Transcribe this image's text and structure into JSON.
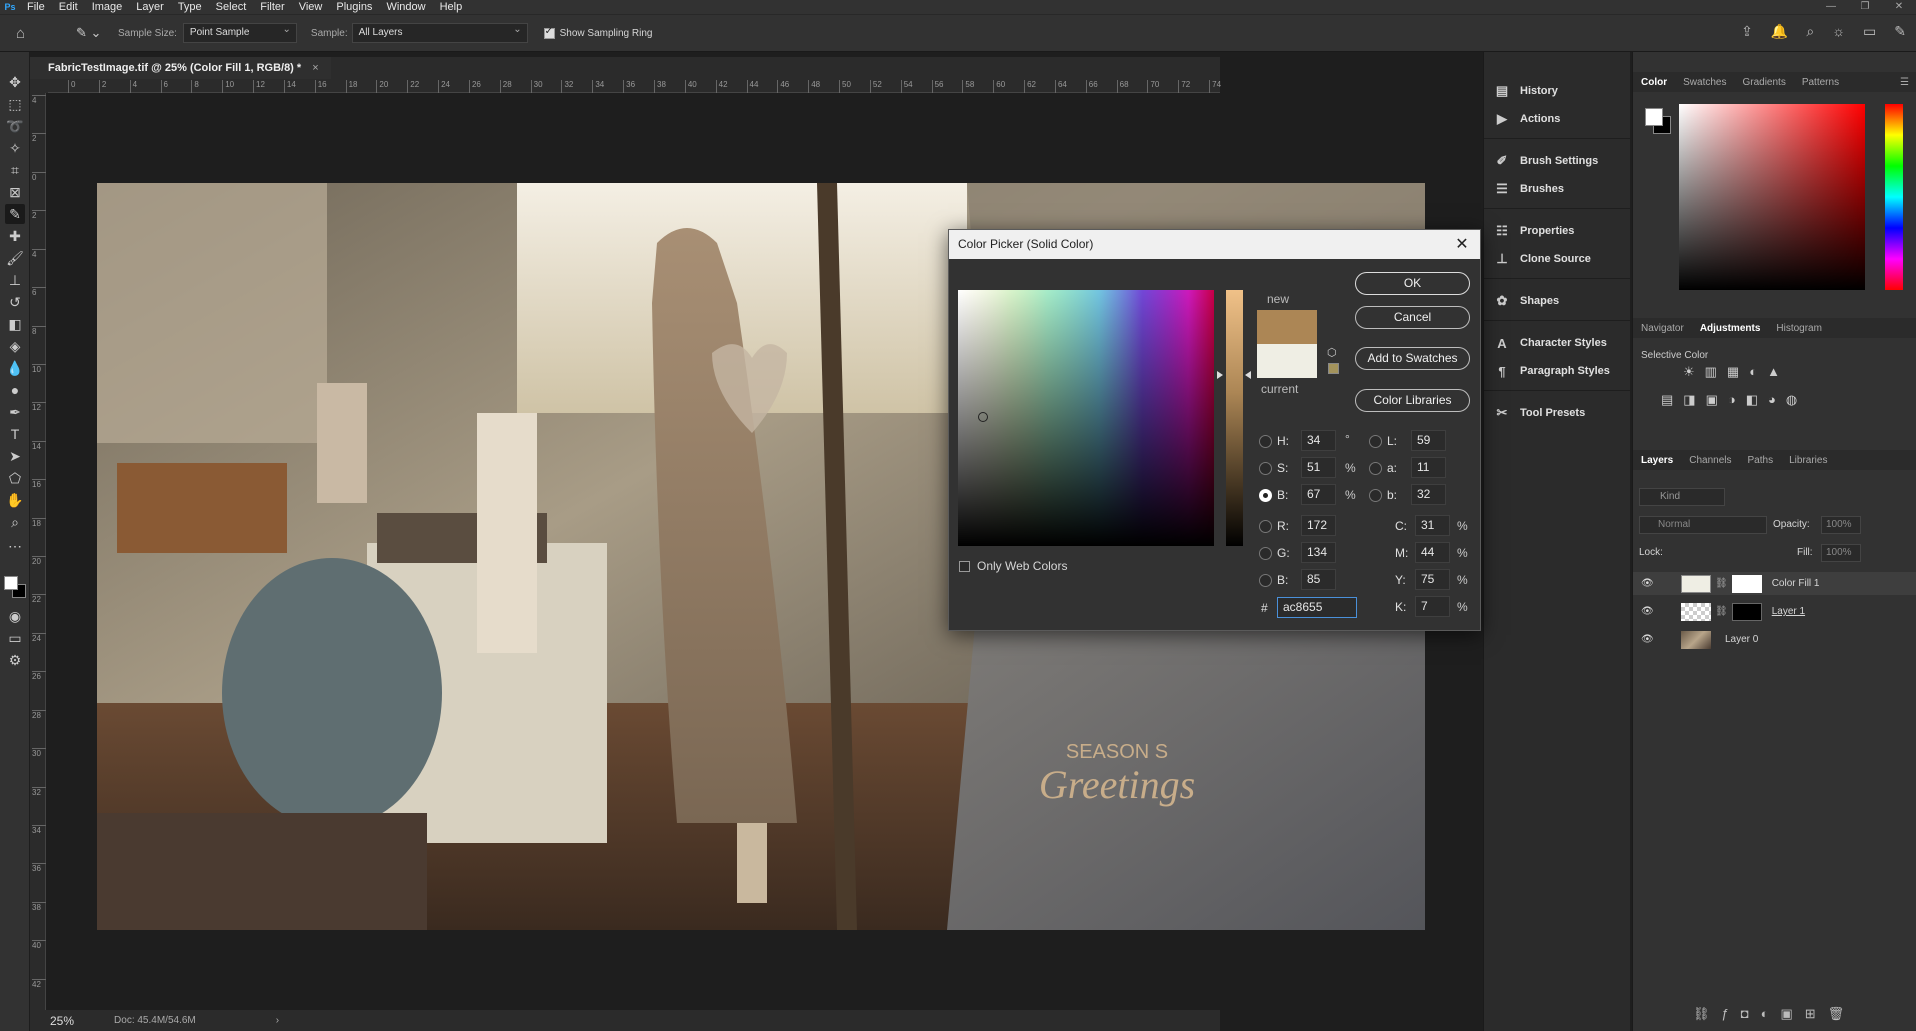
{
  "app": {
    "menu": [
      "File",
      "Edit",
      "Image",
      "Layer",
      "Type",
      "Select",
      "Filter",
      "View",
      "Plugins",
      "Window",
      "Help"
    ],
    "logo": "Ps"
  },
  "options": {
    "sample_size_label": "Sample Size:",
    "sample_size_value": "Point Sample",
    "sample_label": "Sample:",
    "sample_value": "All Layers",
    "sampling_ring_label": "Show Sampling Ring"
  },
  "document": {
    "tab_title": "FabricTestImage.tif @ 25% (Color Fill 1, RGB/8) *",
    "zoom": "25%",
    "doc_info": "Doc: 45.4M/54.6M",
    "ruler_top": [
      "0",
      "2",
      "4",
      "6",
      "8",
      "10",
      "12",
      "14",
      "16",
      "18",
      "20",
      "22",
      "24",
      "26",
      "28",
      "30",
      "32",
      "34",
      "36",
      "38",
      "40",
      "42",
      "44",
      "46",
      "48",
      "50",
      "52",
      "54",
      "56",
      "58",
      "60",
      "62",
      "64",
      "66",
      "68",
      "70",
      "72",
      "74"
    ],
    "ruler_left": [
      "4",
      "2",
      "0",
      "2",
      "4",
      "6",
      "8",
      "10",
      "12",
      "14",
      "16",
      "18",
      "20",
      "22",
      "24",
      "26",
      "28",
      "30",
      "32",
      "34",
      "36",
      "38",
      "40",
      "42"
    ],
    "artwork_text": {
      "line1": "SEASON S",
      "line2": "Greetings"
    }
  },
  "mid_panel": [
    {
      "label": "History",
      "icon": "history-icon"
    },
    {
      "label": "Actions",
      "icon": "actions-play-icon"
    },
    {
      "label": "Brush Settings",
      "icon": "brush-settings-icon"
    },
    {
      "label": "Brushes",
      "icon": "brushes-icon"
    },
    {
      "label": "Properties",
      "icon": "properties-sliders-icon"
    },
    {
      "label": "Clone Source",
      "icon": "clone-source-icon"
    },
    {
      "label": "Shapes",
      "icon": "shapes-icon"
    },
    {
      "label": "Character Styles",
      "icon": "character-styles-icon"
    },
    {
      "label": "Paragraph Styles",
      "icon": "paragraph-styles-icon"
    },
    {
      "label": "Tool Presets",
      "icon": "tool-presets-icon"
    }
  ],
  "color_panel": {
    "tabs": [
      "Color",
      "Swatches",
      "Gradients",
      "Patterns"
    ],
    "active": "Color"
  },
  "adjust_panel": {
    "tabs": [
      "Navigator",
      "Adjustments",
      "Histogram"
    ],
    "active": "Adjustments",
    "subtitle": "Selective Color"
  },
  "layers_panel": {
    "tabs": [
      "Layers",
      "Channels",
      "Paths",
      "Libraries"
    ],
    "active": "Layers",
    "kind": "Kind",
    "blend": "Normal",
    "opacity_label": "Opacity:",
    "opacity": "100%",
    "lock_label": "Lock:",
    "fill_label": "Fill:",
    "fill": "100%",
    "layers": [
      {
        "name": "Color Fill 1",
        "selected": true
      },
      {
        "name": "Layer 1",
        "selected": false
      },
      {
        "name": "Layer 0",
        "selected": false
      }
    ]
  },
  "picker": {
    "title": "Color Picker (Solid Color)",
    "new_label": "new",
    "current_label": "current",
    "new_color": "#ac8655",
    "current_color": "#efeee4",
    "buttons": {
      "ok": "OK",
      "cancel": "Cancel",
      "swatches": "Add to Swatches",
      "libraries": "Color Libraries"
    },
    "only_web": "Only Web Colors",
    "H": "34",
    "S": "51",
    "B": "67",
    "R": "172",
    "G": "134",
    "Bv": "85",
    "L": "59",
    "a": "11",
    "b": "32",
    "C": "31",
    "M": "44",
    "Y": "75",
    "K": "7",
    "hex": "ac8655",
    "labels": {
      "H": "H:",
      "S": "S:",
      "B": "B:",
      "R": "R:",
      "G": "G:",
      "Bv": "B:",
      "L": "L:",
      "a": "a:",
      "b": "b:",
      "C": "C:",
      "M": "M:",
      "Y": "Y:",
      "K": "K:",
      "hash": "#"
    },
    "units": {
      "deg": "°",
      "pct": "%"
    }
  }
}
